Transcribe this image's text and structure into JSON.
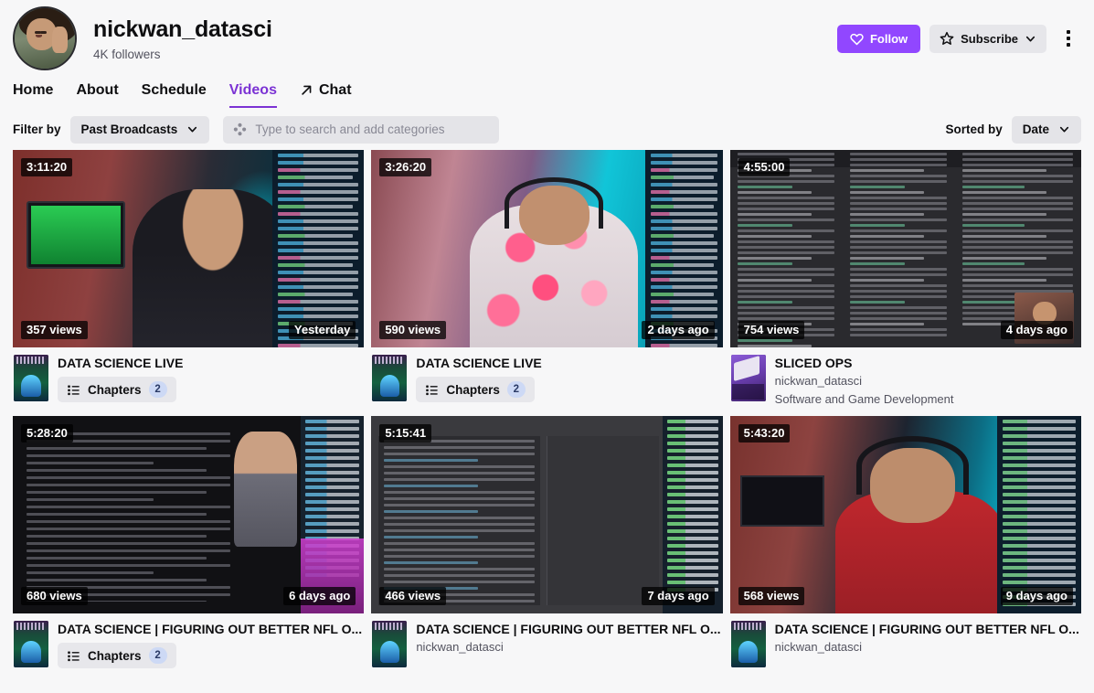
{
  "channel": {
    "name": "nickwan_datasci",
    "followers": "4K followers",
    "follow_label": "Follow",
    "subscribe_label": "Subscribe",
    "accent_color": "#9147ff",
    "avatar_icon": "channel-avatar"
  },
  "nav": {
    "tabs": [
      {
        "label": "Home",
        "active": false,
        "external": false
      },
      {
        "label": "About",
        "active": false,
        "external": false
      },
      {
        "label": "Schedule",
        "active": false,
        "external": false
      },
      {
        "label": "Videos",
        "active": true,
        "external": false
      },
      {
        "label": "Chat",
        "active": false,
        "external": true
      }
    ],
    "active_color": "#7b32d4"
  },
  "filters": {
    "filter_label": "Filter by",
    "filter_value": "Past Broadcasts",
    "search_placeholder": "Type to search and add categories",
    "search_value": "",
    "search_icon": "category-icon",
    "sort_label": "Sorted by",
    "sort_value": "Date"
  },
  "videos": [
    {
      "duration": "3:11:20",
      "views": "357 views",
      "age": "Yesterday",
      "title": "DATA SCIENCE LIVE",
      "channel": "",
      "category": "",
      "chapters_label": "Chapters",
      "chapters_count": "2",
      "boxart": "science-and-technology",
      "scene": "room-red-cyan"
    },
    {
      "duration": "3:26:20",
      "views": "590 views",
      "age": "2 days ago",
      "title": "DATA SCIENCE LIVE",
      "channel": "",
      "category": "",
      "chapters_label": "Chapters",
      "chapters_count": "2",
      "boxart": "science-and-technology",
      "scene": "floral-cyan"
    },
    {
      "duration": "4:55:00",
      "views": "754 views",
      "age": "4 days ago",
      "title": "SLICED OPS",
      "channel": "nickwan_datasci",
      "category": "Software and Game Development",
      "chapters_label": "",
      "chapters_count": "",
      "boxart": "software-and-game-development",
      "scene": "code-dark"
    },
    {
      "duration": "5:28:20",
      "views": "680 views",
      "age": "6 days ago",
      "title": "DATA SCIENCE | FIGURING OUT BETTER NFL O...",
      "channel": "",
      "category": "",
      "chapters_label": "Chapters",
      "chapters_count": "2",
      "boxart": "science-and-technology",
      "scene": "doc-dark"
    },
    {
      "duration": "5:15:41",
      "views": "466 views",
      "age": "7 days ago",
      "title": "DATA SCIENCE | FIGURING OUT BETTER NFL O...",
      "channel": "nickwan_datasci",
      "category": "",
      "chapters_label": "",
      "chapters_count": "",
      "boxart": "science-and-technology",
      "scene": "terminal-dark"
    },
    {
      "duration": "5:43:20",
      "views": "568 views",
      "age": "9 days ago",
      "title": "DATA SCIENCE | FIGURING OUT BETTER NFL O...",
      "channel": "nickwan_datasci",
      "category": "",
      "chapters_label": "",
      "chapters_count": "",
      "boxart": "science-and-technology",
      "scene": "red-shirt"
    }
  ]
}
